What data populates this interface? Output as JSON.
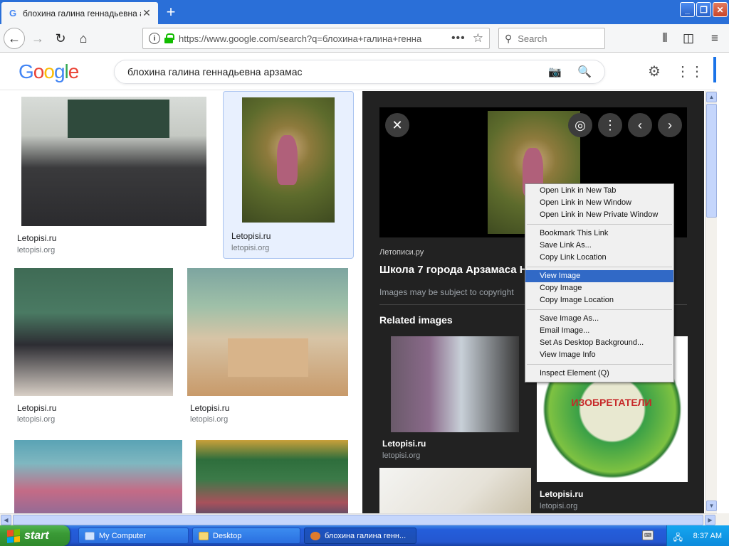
{
  "browser": {
    "tab_title": "блохина галина геннадьевна ар",
    "tab_favicon": "G",
    "url": "https://www.google.com/search?q=блохина+галина+генна",
    "search_placeholder": "Search"
  },
  "google": {
    "logo": [
      "G",
      "o",
      "o",
      "g",
      "l",
      "e"
    ],
    "logo_colors": [
      "#4285f4",
      "#ea4335",
      "#fbbc05",
      "#4285f4",
      "#34a853",
      "#ea4335"
    ],
    "query": "блохина галина геннадьевна арзамас"
  },
  "results": [
    {
      "source": "Letopisi.ru",
      "domain": "letopisi.org"
    },
    {
      "source": "Letopisi.ru",
      "domain": "letopisi.org"
    },
    {
      "source": "Letopisi.ru",
      "domain": "letopisi.org"
    },
    {
      "source": "Letopisi.ru",
      "domain": "letopisi.org"
    }
  ],
  "panel": {
    "site": "Летописи.ру",
    "title": "Школа 7 города Арзамаса Ни",
    "copyright": "Images may be subject to copyright",
    "related_heading": "Related images",
    "related": [
      {
        "source": "Letopisi.ru",
        "domain": "letopisi.org"
      },
      {
        "source": "Letopisi.ru",
        "domain": "letopisi.org",
        "badge_text": "ИЗОБРЕТАТЕЛИ"
      }
    ]
  },
  "context_menu": {
    "groups": [
      [
        "Open Link in New Tab",
        "Open Link in New Window",
        "Open Link in New Private Window"
      ],
      [
        "Bookmark This Link",
        "Save Link As...",
        "Copy Link Location"
      ],
      [
        "View Image",
        "Copy Image",
        "Copy Image Location"
      ],
      [
        "Save Image As...",
        "Email Image...",
        "Set As Desktop Background...",
        "View Image Info"
      ],
      [
        "Inspect Element (Q)"
      ]
    ],
    "highlighted": "View Image"
  },
  "taskbar": {
    "start_label": "start",
    "items": [
      "My Computer",
      "Desktop",
      "блохина галина генн..."
    ],
    "clock": "8:37 AM"
  },
  "colors": {
    "accent": "#1a73e8",
    "menu_highlight": "#3169c6",
    "panel_bg": "#222222"
  }
}
